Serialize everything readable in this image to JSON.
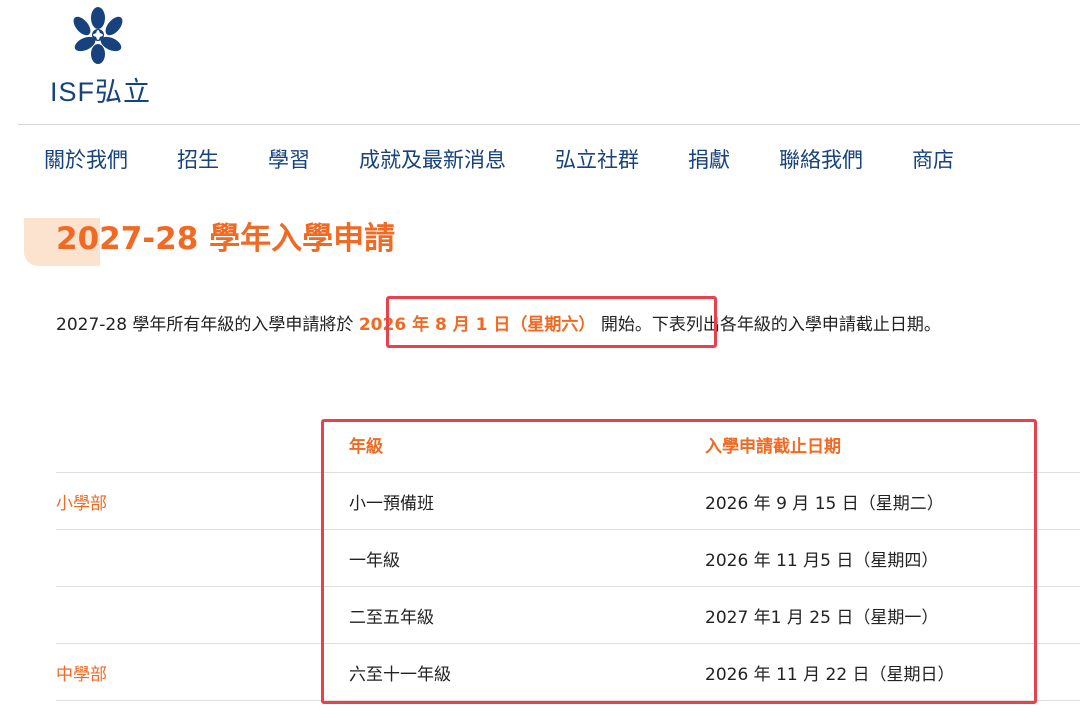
{
  "brand": {
    "name": "ISF弘立",
    "primary_color": "#17427e",
    "accent_color": "#f06a24"
  },
  "nav": {
    "items": [
      {
        "label": "關於我們"
      },
      {
        "label": "招生"
      },
      {
        "label": "學習"
      },
      {
        "label": "成就及最新消息"
      },
      {
        "label": "弘立社群"
      },
      {
        "label": "捐獻"
      },
      {
        "label": "聯絡我們"
      },
      {
        "label": "商店"
      }
    ]
  },
  "main": {
    "title": "2027-28 學年入學申請",
    "intro": {
      "before": "2027-28 學年所有年級的入學申請將於 ",
      "highlight": "2026 年 8 月 1 日（星期六）",
      "after": " 開始。下表列出各年級的入學申請截止日期。"
    },
    "annotation_color": "#e8414c",
    "table": {
      "headers": {
        "grade": "年級",
        "deadline": "入學申請截止日期"
      },
      "rows": [
        {
          "division": "小學部",
          "grade": "小一預備班",
          "deadline": "2026 年 9 月 15 日（星期二）"
        },
        {
          "division": "",
          "grade": "一年級",
          "deadline": "2026 年 11 月5 日（星期四）"
        },
        {
          "division": "",
          "grade": "二至五年級",
          "deadline": "2027 年1 月 25 日（星期一）"
        },
        {
          "division": "中學部",
          "grade": "六至十一年級",
          "deadline": "2026 年 11 月 22 日（星期日）"
        }
      ]
    }
  }
}
